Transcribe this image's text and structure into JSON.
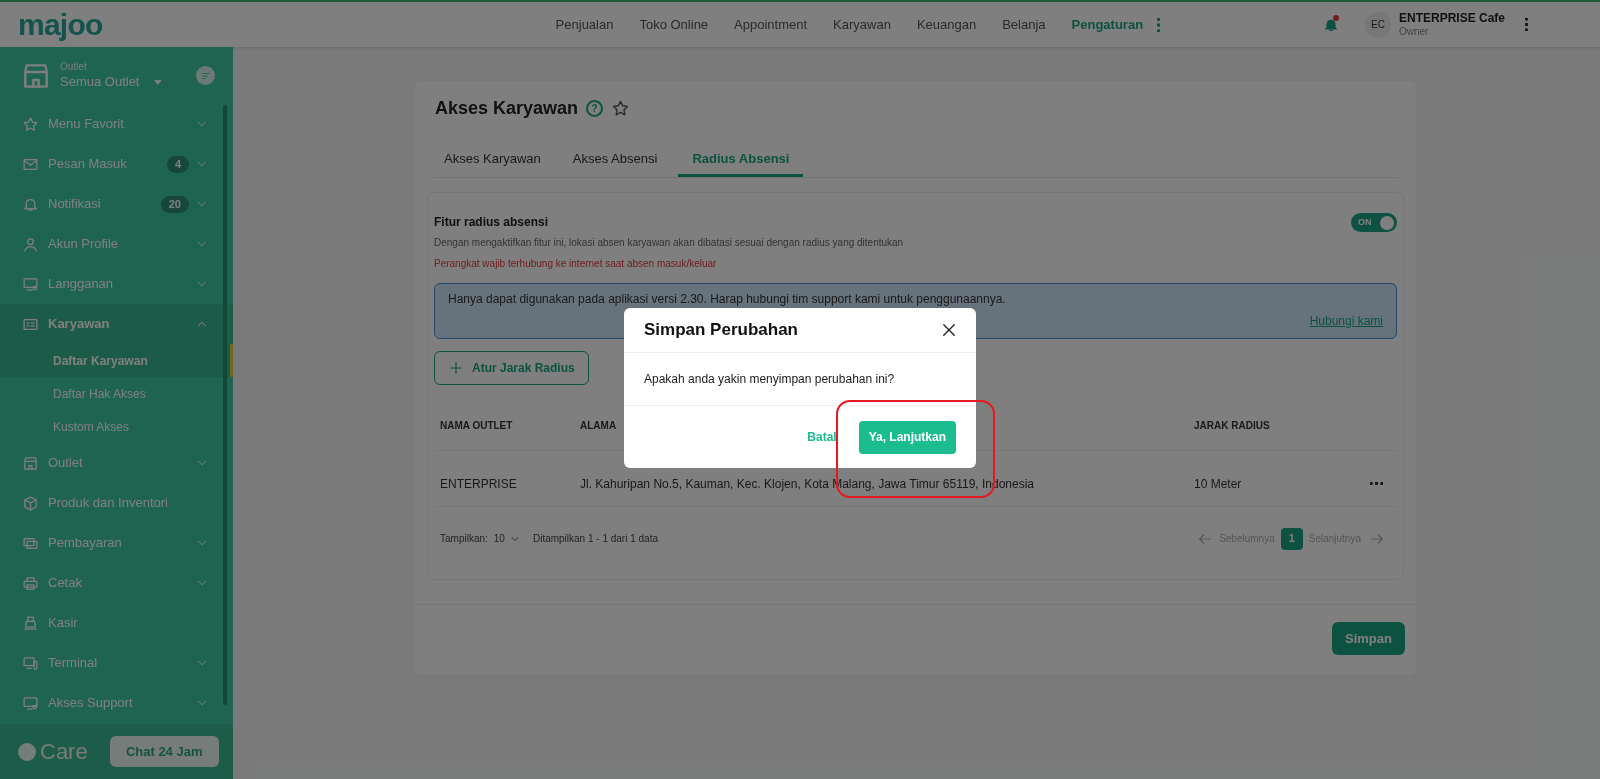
{
  "topbar": {
    "logo": "majoo",
    "nav": [
      {
        "label": "Penjualan",
        "selected": false
      },
      {
        "label": "Toko Online",
        "selected": false
      },
      {
        "label": "Appointment",
        "selected": false
      },
      {
        "label": "Karyawan",
        "selected": false
      },
      {
        "label": "Keuangan",
        "selected": false
      },
      {
        "label": "Belanja",
        "selected": false
      },
      {
        "label": "Pengaturan",
        "selected": true
      }
    ],
    "notification_dot": true,
    "user": {
      "initials": "EC",
      "name": "ENTERPRISE Cafe",
      "role": "Owner"
    }
  },
  "sidebar": {
    "outlet_label": "Outlet",
    "outlet_value": "Semua Outlet",
    "items": [
      {
        "label": "Menu Favorit",
        "expandable": true,
        "expanded": false
      },
      {
        "label": "Pesan Masuk",
        "badge": "4",
        "expandable": true,
        "expanded": false
      },
      {
        "label": "Notifikasi",
        "badge": "20",
        "expandable": true,
        "expanded": false
      },
      {
        "label": "Akun Profile",
        "expandable": true,
        "expanded": false
      },
      {
        "label": "Langganan",
        "expandable": true,
        "expanded": false
      },
      {
        "label": "Karyawan",
        "expandable": true,
        "expanded": true,
        "children": [
          {
            "label": "Daftar Karyawan",
            "selected": true
          },
          {
            "label": "Daftar Hak Akses",
            "selected": false
          },
          {
            "label": "Kustom Akses",
            "selected": false
          }
        ]
      },
      {
        "label": "Outlet",
        "expandable": true,
        "expanded": false
      },
      {
        "label": "Produk dan Inventori",
        "expandable": false,
        "expanded": false
      },
      {
        "label": "Pembayaran",
        "expandable": true,
        "expanded": false
      },
      {
        "label": "Cetak",
        "expandable": true,
        "expanded": false
      },
      {
        "label": "Kasir",
        "expandable": false,
        "expanded": false
      },
      {
        "label": "Terminal",
        "expandable": true,
        "expanded": false
      },
      {
        "label": "Akses Support",
        "expandable": true,
        "expanded": false
      }
    ],
    "care_logo": "Care",
    "chat_button": "Chat 24 Jam"
  },
  "page": {
    "title": "Akses Karyawan",
    "help_icon": "?",
    "tabs": [
      {
        "label": "Akses Karyawan",
        "selected": false
      },
      {
        "label": "Akses Absensi",
        "selected": false
      },
      {
        "label": "Radius Absensi",
        "selected": true
      }
    ],
    "feature": {
      "title": "Fitur radius absensi",
      "description": "Dengan mengaktifkan fitur ini, lokasi absen karyawan akan dibatasi sesuai dengan radius yang ditentukan",
      "warning": "Perangkat wajib terhubung ke internet saat absen masuk/keluar",
      "toggle": {
        "label": "ON",
        "on": true
      }
    },
    "info": {
      "text": "Hanya dapat digunakan pada aplikasi versi 2.30. Harap hubungi tim support kami untuk penggunaannya.",
      "link": "Hubungi kami"
    },
    "add_button": "Atur Jarak Radius",
    "table": {
      "columns": [
        "NAMA OUTLET",
        "ALAMA",
        "JARAK RADIUS"
      ],
      "rows": [
        {
          "cells": [
            "ENTERPRISE",
            "Jl. Kahuripan No.5, Kauman, Kec. Klojen, Kota Malang, Jawa Timur 65119, Indonesia",
            "10 Meter"
          ]
        }
      ]
    },
    "pagination": {
      "show_label": "Tampilkan:",
      "page_size": "10",
      "summary": "Ditampilkan 1 - 1 dari 1 data",
      "prev": "Sebelumnya",
      "pages": [
        {
          "label": "1",
          "selected": true
        }
      ],
      "next": "Selanjutnya"
    },
    "save_button": "Simpan"
  },
  "modal": {
    "title": "Simpan Perubahan",
    "message": "Apakah anda yakin menyimpan perubahan ini?",
    "cancel": "Batal",
    "confirm": "Ya, Lanjutkan"
  }
}
